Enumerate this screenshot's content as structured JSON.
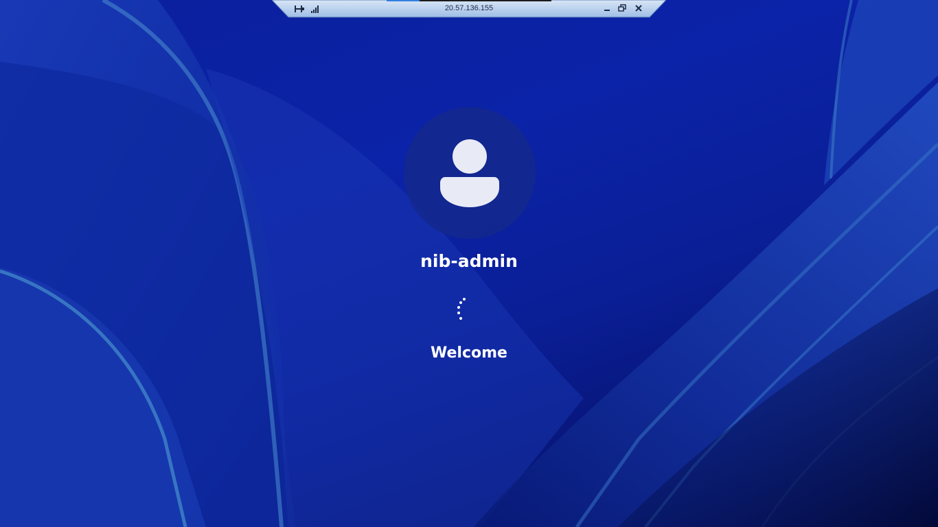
{
  "connection_bar": {
    "host": "20.57.136.155",
    "progress": 0.2,
    "icons": {
      "pin": "pin-icon",
      "signal": "connection-signal-icon",
      "minimize": "minimize-icon",
      "restore": "restore-icon",
      "close": "close-icon"
    }
  },
  "login": {
    "username": "nib-admin",
    "status": "Welcome",
    "avatar_icon": "user-avatar-icon",
    "spinner_icon": "loading-spinner-icon"
  },
  "colors": {
    "wallpaper_base": "#0b23a8",
    "text": "#ffffff",
    "avatar_bg": "#14288c"
  }
}
